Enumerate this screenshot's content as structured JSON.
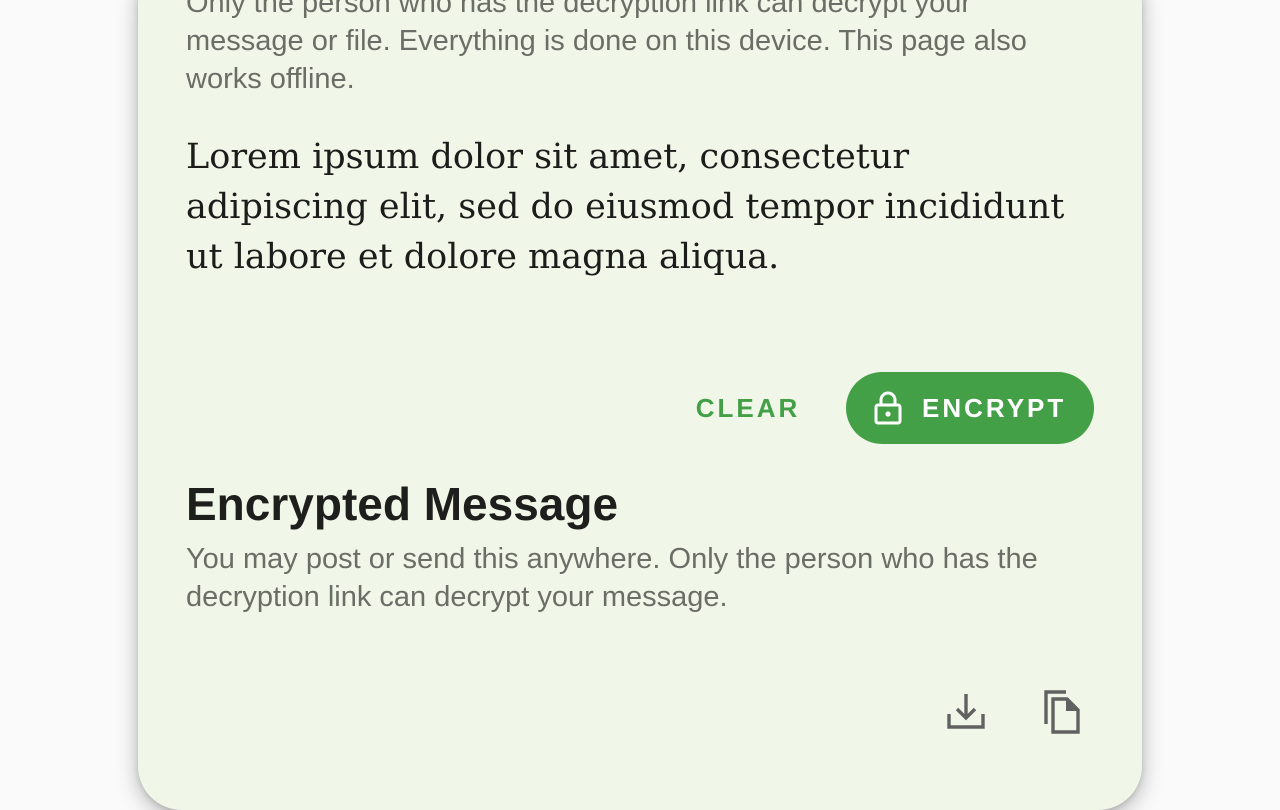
{
  "intro": {
    "text": "Only the person who has the decryption link can decrypt your message or file. Everything is done on this device. This page also works offline."
  },
  "message": {
    "value": "Lorem ipsum dolor sit amet, consectetur adipiscing elit, sed do eiusmod tempor incididunt ut labore et dolore magna aliqua."
  },
  "actions": {
    "clear_label": "CLEAR",
    "encrypt_label": "ENCRYPT",
    "encrypt_icon": "lock-icon"
  },
  "encrypted": {
    "title": "Encrypted Message",
    "description": "You may post or send this anywhere. Only the person who has the decryption link can decrypt your message.",
    "download_icon": "download-icon",
    "copy_icon": "copy-icon"
  },
  "colors": {
    "accent": "#43a047",
    "card_background": "#f0f6e8",
    "page_background": "#fafafa",
    "secondary_text": "#6b6e66",
    "primary_text": "#1c1c1a"
  }
}
